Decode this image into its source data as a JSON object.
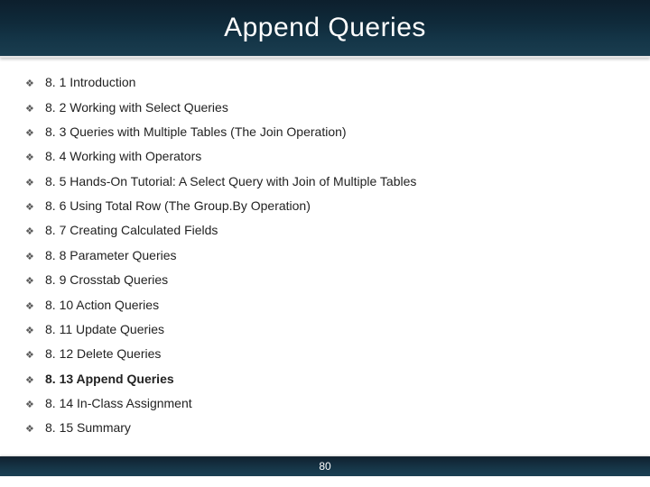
{
  "title": "Append Queries",
  "page_number": "80",
  "toc": {
    "items": [
      {
        "label": "8. 1 Introduction",
        "active": false
      },
      {
        "label": "8. 2 Working with Select Queries",
        "active": false
      },
      {
        "label": "8. 3 Queries with Multiple Tables (The Join Operation)",
        "active": false
      },
      {
        "label": "8. 4 Working with Operators",
        "active": false
      },
      {
        "label": "8. 5 Hands-On Tutorial: A Select Query with Join of Multiple Tables",
        "active": false
      },
      {
        "label": "8. 6 Using Total Row (The Group.By Operation)",
        "active": false
      },
      {
        "label": "8. 7 Creating Calculated Fields",
        "active": false
      },
      {
        "label": "8. 8 Parameter Queries",
        "active": false
      },
      {
        "label": "8. 9 Crosstab Queries",
        "active": false
      },
      {
        "label": "8. 10 Action Queries",
        "active": false
      },
      {
        "label": "8. 11 Update Queries",
        "active": false
      },
      {
        "label": "8. 12 Delete Queries",
        "active": false
      },
      {
        "label": "8. 13 Append Queries",
        "active": true
      },
      {
        "label": "8. 14 In-Class Assignment",
        "active": false
      },
      {
        "label": "8. 15 Summary",
        "active": false
      }
    ]
  }
}
